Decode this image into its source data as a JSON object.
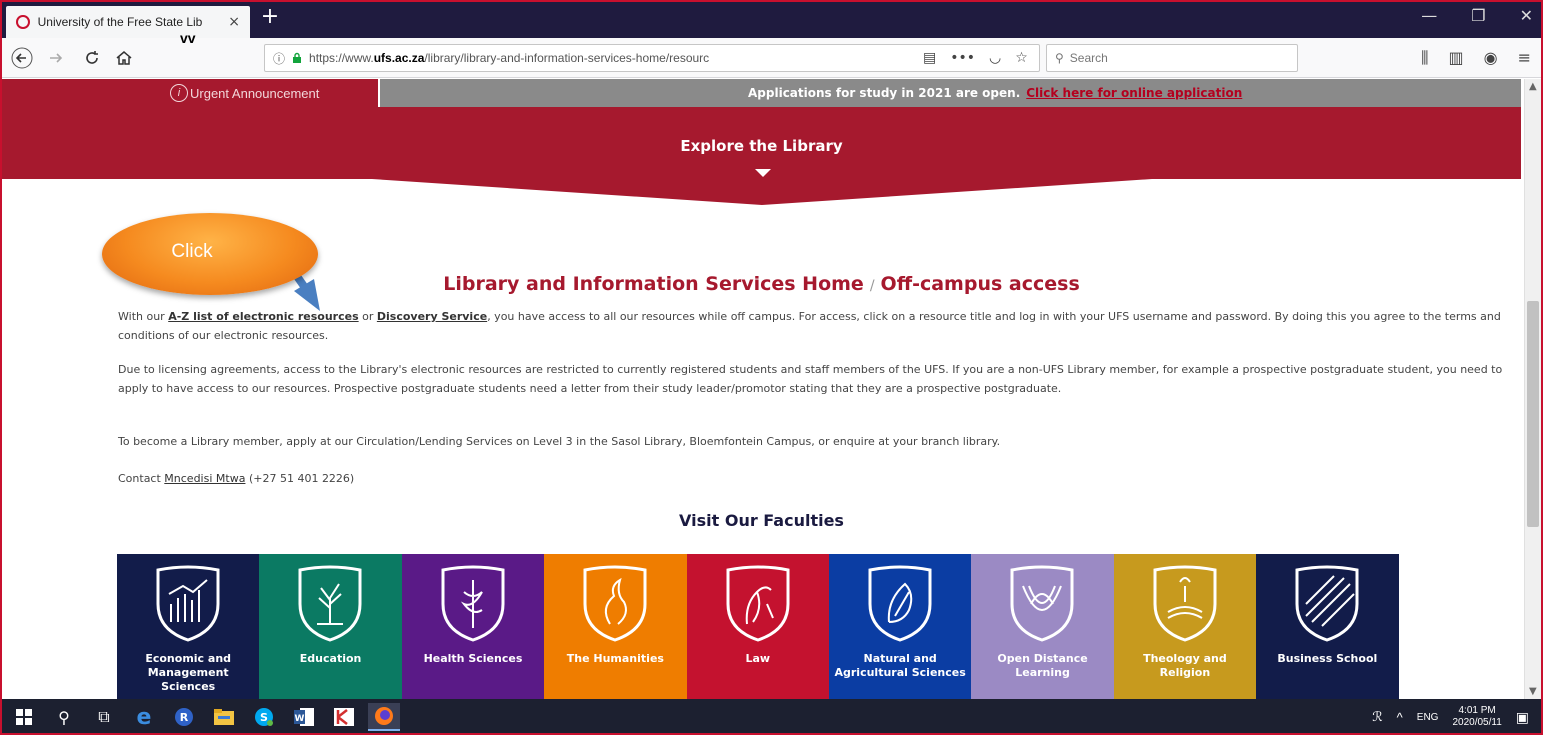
{
  "browser": {
    "tab_title": "University of the Free State Lib",
    "tab_close": "×",
    "new_tab": "+",
    "overlay_text": "vv",
    "url_prefix": "https://www.",
    "url_domain": "ufs.ac.za",
    "url_path": "/library/library-and-information-services-home/resourc",
    "search_placeholder": "Search",
    "win_minimize": "—",
    "win_restore": "❐",
    "win_close": "✕"
  },
  "announcement": {
    "label": "Urgent Announcement",
    "icon": "i",
    "message": "Applications for study in 2021 are open.",
    "link": "Click here for online application"
  },
  "explore": {
    "title": "Explore the Library"
  },
  "heading": {
    "home": "Library and Information Services Home",
    "separator": "/",
    "current": "Off-campus access"
  },
  "paragraphs": {
    "p1_before": "With our ",
    "p1_link1": "A-Z list of electronic resources",
    "p1_mid": " or ",
    "p1_link2": "Discovery Service",
    "p1_after": ", you have access to all our resources while off campus. For access, click on a resource title and log in with your UFS username and password. By doing this you agree to the terms and conditions of our electronic resources.",
    "p2": "Due to licensing agreements, access to the Library's electronic resources are restricted to currently registered students and staff members of the UFS. If you are a non-UFS Library member, for example a prospective postgraduate student, you need to apply to have access to our resources. Prospective postgraduate students need a letter from their study leader/promotor stating that they are a prospective postgraduate.",
    "p3": "To become a Library member, apply at our Circulation/Lending Services on Level 3 in the Sasol Library, Bloemfontein Campus, or enquire at your branch library.",
    "p4_before": "Contact ",
    "p4_link": "Mncedisi Mtwa",
    "p4_after": " (+27 51 401 2226)"
  },
  "faculties": {
    "title": "Visit Our Faculties",
    "items": [
      {
        "label": "Economic and Management Sciences",
        "color": "#121c4a"
      },
      {
        "label": "Education",
        "color": "#0b7a63"
      },
      {
        "label": "Health Sciences",
        "color": "#5a1a87"
      },
      {
        "label": "The Humanities",
        "color": "#ef7d00"
      },
      {
        "label": "Law",
        "color": "#c4122f"
      },
      {
        "label": "Natural and Agricultural Sciences",
        "color": "#0b3da3"
      },
      {
        "label": "Open Distance Learning",
        "color": "#9b8ac4"
      },
      {
        "label": "Theology and Religion",
        "color": "#c79a1e"
      },
      {
        "label": "Business School",
        "color": "#121c4a"
      }
    ]
  },
  "callout": {
    "text": "Click"
  },
  "taskbar": {
    "language": "ENG",
    "time": "4:01 PM",
    "date": "2020/05/11"
  },
  "colors": {
    "brand_red": "#a6192e",
    "callout_orange": "#f58a1f",
    "arrow_blue": "#4a7fc1"
  }
}
